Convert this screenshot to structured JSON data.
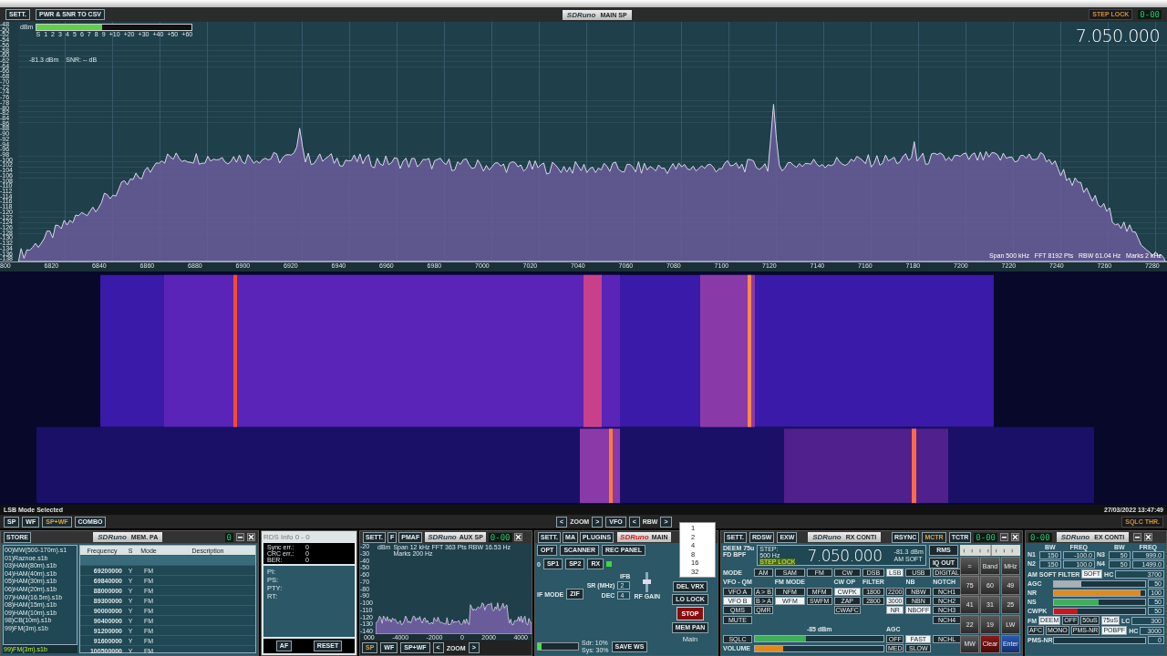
{
  "top_bar": {
    "buttons": [
      "SETT.",
      "PWR & SNR TO CSV"
    ],
    "logo": "SDRuno",
    "title": "MAIN SP",
    "step_lock": "STEP LOCK",
    "counter": "0-00"
  },
  "spectrum": {
    "unit": "dBm",
    "y_labels": [
      "-48",
      "-50",
      "-52",
      "-54",
      "-56",
      "-58",
      "-60",
      "-62",
      "-64",
      "-66",
      "-68",
      "-70",
      "-72",
      "-74",
      "-76",
      "-78",
      "-80",
      "-82",
      "-84",
      "-86",
      "-88",
      "-90",
      "-92",
      "-94",
      "-96",
      "-98",
      "-100",
      "-102",
      "-104",
      "-106",
      "-108",
      "-110",
      "-112",
      "-114",
      "-116",
      "-118",
      "-120",
      "-122",
      "-124",
      "-126",
      "-128",
      "-130",
      "-132",
      "-134",
      "-136",
      "-138"
    ],
    "s_meter": {
      "level": 0.42,
      "scale": [
        "S",
        "1",
        "2",
        "3",
        "4",
        "5",
        "6",
        "7",
        "8",
        "9",
        "+10",
        "+20",
        "+30",
        "+40",
        "+50",
        "+60"
      ]
    },
    "reading": "-81.3 dBm",
    "snr": "SNR: -- dB",
    "frequency": "7.050.000",
    "info": "Span 500 kHz   FFT 8192 Pts   RBW 61.04 Hz   Marks 2 kHz",
    "x_labels": [
      "800",
      "6820",
      "6840",
      "6860",
      "6880",
      "6900",
      "6920",
      "6940",
      "6960",
      "6980",
      "7000",
      "7020",
      "7040",
      "7060",
      "7080",
      "7100",
      "7120",
      "7140",
      "7160",
      "7180",
      "7200",
      "7220",
      "7240",
      "7260",
      "7280"
    ]
  },
  "status_bar": {
    "message": "LSB Mode Selected",
    "datetime": "27/03/2022 13:47:49"
  },
  "view_bar": {
    "views": [
      {
        "label": "SP",
        "selected": false
      },
      {
        "label": "WF",
        "selected": false
      },
      {
        "label": "SP+WF",
        "selected": true
      },
      {
        "label": "COMBO",
        "selected": false
      }
    ],
    "controls": [
      {
        "kind": "stepper",
        "label": "ZOOM",
        "prev": "<",
        "next": ">"
      },
      {
        "kind": "button",
        "label": "VFO"
      },
      {
        "kind": "stepper",
        "label": "RBW",
        "prev": "<",
        "next": ">"
      }
    ],
    "sqlc": "SQLC THR."
  },
  "memory_panel": {
    "store": "STORE",
    "logo": "SDRuno",
    "title": "MEM. PA",
    "counter": "0",
    "files": [
      "00)MW(500-170m).s1",
      "01)Raznoe.s1b",
      "03)HAM(80m).s1b",
      "04)HAM(40m).s1b",
      "05)HAM(30m).s1b",
      "06)HAM(20m).s1b",
      "07)HAM(16.5m).s1b",
      "08)HAM(15m).s1b",
      "09)HAM(10m).s1b",
      "98)CB(10m).s1b",
      "99)FM(3m).s1b"
    ],
    "current_file": "99)FM(3m).s1b",
    "columns": [
      "Frequency",
      "S",
      "Mode",
      "Description"
    ],
    "rows": [
      {
        "frequency": "69200000",
        "s": "Y",
        "mode": "FM"
      },
      {
        "frequency": "69840000",
        "s": "Y",
        "mode": "FM"
      },
      {
        "frequency": "88000000",
        "s": "Y",
        "mode": "FM"
      },
      {
        "frequency": "89300000",
        "s": "Y",
        "mode": "FM"
      },
      {
        "frequency": "90000000",
        "s": "Y",
        "mode": "FM"
      },
      {
        "frequency": "90400000",
        "s": "Y",
        "mode": "FM"
      },
      {
        "frequency": "91200000",
        "s": "Y",
        "mode": "FM"
      },
      {
        "frequency": "91600000",
        "s": "Y",
        "mode": "FM"
      },
      {
        "frequency": "100500000",
        "s": "Y",
        "mode": "FM"
      }
    ]
  },
  "rds_panel": {
    "title": "RDS Info 0 - 0",
    "stats": [
      {
        "label": "Sync err.:",
        "value": "0"
      },
      {
        "label": "CRC err.:",
        "value": "0"
      },
      {
        "label": "BER:",
        "value": "0"
      }
    ],
    "fields": [
      "PI:",
      "PS:",
      "PTY:",
      "RT:"
    ],
    "buttons": [
      "AF",
      "RESET"
    ]
  },
  "aux_sp": {
    "buttons": [
      "SETT.",
      "F",
      "PMAF"
    ],
    "logo": "SDRuno",
    "title": "AUX SP",
    "counter": "0-00",
    "unit": "dBm",
    "info": "Span 12 kHz FFT 363 Pts RBW 16.53 Hz Marks 200 Hz",
    "y_labels": [
      "-20",
      "-30",
      "-40",
      "-50",
      "-60",
      "-70",
      "-80",
      "-90",
      "-100",
      "-110",
      "-120",
      "-130",
      "-140"
    ],
    "x_labels": [
      "000",
      "-4000",
      "-2000",
      "0",
      "2000",
      "4000"
    ],
    "views": [
      {
        "label": "SP",
        "selected": true
      },
      {
        "label": "WF",
        "selected": false
      },
      {
        "label": "SP+WF",
        "selected": false
      }
    ],
    "zoom": {
      "prev": "<",
      "label": "ZOOM",
      "next": ">"
    }
  },
  "main_panel": {
    "buttons": [
      "SETT.",
      "MA",
      "PLUGINS"
    ],
    "logo": "SDRuno",
    "title": "MAIN",
    "tools": [
      "OPT",
      "SCANNER",
      "REC PANEL"
    ],
    "rx_index": "0",
    "rx_buttons": [
      "SP1",
      "SP2",
      "RX"
    ],
    "sr_label": "SR (MHz)",
    "sr_value": "2",
    "dec_label": "DEC",
    "dec_value": "4",
    "ifb_label": "IFB",
    "side_buttons": [
      "DEL VRX",
      "LO LOCK"
    ],
    "stop": "STOP",
    "mem_pan": "MEM PAN",
    "if_mode_label": "IF MODE",
    "if_mode": "ZIF",
    "rf_gain_label": "RF GAIN",
    "rf_gain": {
      "level": 0.5
    },
    "cpu": {
      "level": 0.08
    },
    "sdr": "Sdr: 10%",
    "sys": "Sys: 30%",
    "save": "SAVE WS",
    "name": "Main",
    "dropdown": [
      "1",
      "2",
      "4",
      "8",
      "16",
      "32"
    ]
  },
  "rx_control": {
    "buttons": [
      "SETT.",
      "RDSW",
      "EXW"
    ],
    "logo": "SDRuno",
    "title": "RX CONTI",
    "toggles": [
      {
        "label": "RSYNC",
        "selected": false
      },
      {
        "label": "MCTR",
        "selected": true
      },
      {
        "label": "TCTR",
        "selected": false
      }
    ],
    "counter": "0-00",
    "deem": "DEEM 75u",
    "fd": "FD BPF",
    "step": "STEP:",
    "step_value": "500 Hz",
    "step_lock": "STEP LOCK",
    "frequency": "7.050.000",
    "level": "-81.3 dBm",
    "agc_mode": "AM SOFT",
    "side": [
      "RMS",
      "IQ OUT"
    ],
    "rows": [
      [
        {
          "kind": "label",
          "text": "MODE"
        },
        {
          "kind": "button",
          "label": "AM",
          "selected": false
        },
        {
          "kind": "button",
          "label": "SAM",
          "selected": false
        },
        {
          "kind": "button",
          "label": "FM",
          "selected": false
        },
        {
          "kind": "button",
          "label": "CW",
          "selected": false
        },
        {
          "kind": "button",
          "label": "DSB",
          "selected": false
        },
        {
          "kind": "button",
          "label": "LSB",
          "selected": true
        },
        {
          "kind": "button",
          "label": "USB",
          "selected": false
        },
        {
          "kind": "button",
          "label": "DIGITAL",
          "selected": false
        }
      ],
      [
        {
          "kind": "label",
          "text": "VFO - QM"
        },
        {
          "kind": "gap"
        },
        {
          "kind": "label",
          "text": "FM MODE"
        },
        {
          "kind": "gap"
        },
        {
          "kind": "label",
          "text": "CW OP"
        },
        {
          "kind": "label",
          "text": "FILTER"
        },
        {
          "kind": "gap"
        },
        {
          "kind": "label",
          "text": "NB"
        },
        {
          "kind": "label",
          "text": "NOTCH"
        }
      ],
      [
        {
          "kind": "button",
          "label": "VFO A",
          "selected": false
        },
        {
          "kind": "button",
          "label": "A > B",
          "selected": false
        },
        {
          "kind": "button",
          "label": "NFM",
          "selected": false
        },
        {
          "kind": "button",
          "label": "MFM",
          "selected": false
        },
        {
          "kind": "button",
          "label": "CWPK",
          "selected": true
        },
        {
          "kind": "button",
          "label": "1800",
          "selected": false
        },
        {
          "kind": "button",
          "label": "2200",
          "selected": false
        },
        {
          "kind": "button",
          "label": "NBW",
          "selected": false
        },
        {
          "kind": "button",
          "label": "NCH1",
          "selected": false
        }
      ],
      [
        {
          "kind": "button",
          "label": "VFO B",
          "selected": true
        },
        {
          "kind": "button",
          "label": "B > A",
          "selected": false
        },
        {
          "kind": "button",
          "label": "WFM",
          "selected": true
        },
        {
          "kind": "button",
          "label": "SWFM",
          "selected": false
        },
        {
          "kind": "button",
          "label": "ZAP",
          "selected": false
        },
        {
          "kind": "button",
          "label": "2800",
          "selected": false
        },
        {
          "kind": "button",
          "label": "3000",
          "selected": true
        },
        {
          "kind": "button",
          "label": "NBN",
          "selected": false
        },
        {
          "kind": "button",
          "label": "NCH2",
          "selected": false
        }
      ],
      [
        {
          "kind": "button",
          "label": "QMS",
          "selected": false
        },
        {
          "kind": "button",
          "label": "QMR",
          "selected": false
        },
        {
          "kind": "gap"
        },
        {
          "kind": "gap"
        },
        {
          "kind": "button",
          "label": "CWAFC",
          "selected": false
        },
        {
          "kind": "gap"
        },
        {
          "kind": "button",
          "label": "NR",
          "selected": true
        },
        {
          "kind": "button",
          "label": "NBOFF",
          "selected": true
        },
        {
          "kind": "button",
          "label": "NCH3",
          "selected": false
        }
      ],
      [
        {
          "kind": "button",
          "label": "MUTE",
          "selected": false
        },
        {
          "kind": "gap"
        },
        {
          "kind": "gap"
        },
        {
          "kind": "gap"
        },
        {
          "kind": "gap"
        },
        {
          "kind": "gap"
        },
        {
          "kind": "gap"
        },
        {
          "kind": "gap"
        },
        {
          "kind": "button",
          "label": "NCH4",
          "selected": false
        }
      ]
    ],
    "levels": {
      "reading": "-85 dBm",
      "agc_label": "AGC",
      "rows": [
        {
          "kind": "button",
          "label": "SQLC",
          "level": 0.4,
          "color": "#3fae5a",
          "buttons": [
            {
              "label": "OFF",
              "selected": false
            },
            {
              "label": "FAST",
              "selected": true
            },
            {
              "label": "NCHL",
              "selected": false
            }
          ]
        },
        {
          "kind": "label",
          "label": "VOLUME",
          "level": 0.22,
          "color": "#e08a1e",
          "buttons": [
            {
              "label": "MED",
              "selected": false
            },
            {
              "label": "SLOW",
              "selected": false
            }
          ]
        }
      ]
    },
    "keypad": [
      {
        "kind": "key",
        "label": "="
      },
      {
        "kind": "key",
        "label": "Band"
      },
      {
        "kind": "key",
        "label": "MHz"
      },
      {
        "kind": "key",
        "label": "75"
      },
      {
        "kind": "key",
        "label": "60"
      },
      {
        "kind": "key",
        "label": "49"
      },
      {
        "kind": "key",
        "label": "41"
      },
      {
        "kind": "key",
        "label": "31"
      },
      {
        "kind": "key",
        "label": "25"
      },
      {
        "kind": "key",
        "label": "22"
      },
      {
        "kind": "key",
        "label": "19"
      },
      {
        "kind": "key",
        "label": "LW"
      },
      {
        "kind": "key",
        "label": "MW"
      },
      {
        "kind": "clear",
        "label": "Clear"
      },
      {
        "kind": "enter",
        "label": "Enter"
      }
    ]
  },
  "ex_control": {
    "counter": "0-00",
    "logo": "SDRuno",
    "title": "EX CONTI",
    "headers": [
      "BW",
      "FREQ",
      "BW",
      "FREQ"
    ],
    "notches": [
      {
        "name": "N1",
        "bw": "150",
        "freq": "-100.0"
      },
      {
        "name": "N3",
        "bw": "50",
        "freq": "999.0"
      },
      {
        "name": "N2",
        "bw": "150",
        "freq": "100.0"
      },
      {
        "name": "N4",
        "bw": "50",
        "freq": "1499.0"
      }
    ],
    "am_filter_label": "AM SOFT FILTER",
    "am_filter": {
      "label": "SOFT",
      "selected": true
    },
    "hc_label": "HC",
    "hc_value": "3700",
    "sliders": [
      {
        "name": "AGC",
        "level": 0.3,
        "color": "#a8b0b4",
        "value": "50"
      },
      {
        "name": "NR",
        "level": 0.95,
        "color": "#e08a1e",
        "value": "100"
      },
      {
        "name": "NS",
        "level": 0.49,
        "color": "#3fae5a",
        "value": "50"
      },
      {
        "name": "CWPK",
        "level": 0.26,
        "color": "#c8161b",
        "value": "50"
      }
    ],
    "fm_label": "FM",
    "fm_buttons": [
      {
        "label": "DEEM",
        "selected": true
      },
      {
        "label": "OFF",
        "selected": false
      },
      {
        "label": "50uS",
        "selected": false
      },
      {
        "label": "75uS",
        "selected": true
      }
    ],
    "lc_label": "LC",
    "lc_value": "300",
    "fm_buttons2": [
      {
        "label": "AFC",
        "selected": false
      },
      {
        "label": "MONO",
        "selected": false
      },
      {
        "label": "PMS-NR",
        "selected": false
      },
      {
        "label": "POBPF",
        "selected": true
      }
    ],
    "hc2_label": "HC",
    "hc2_value": "3000",
    "pms": {
      "name": "PMS-NR",
      "level": 0,
      "value": "0"
    }
  }
}
